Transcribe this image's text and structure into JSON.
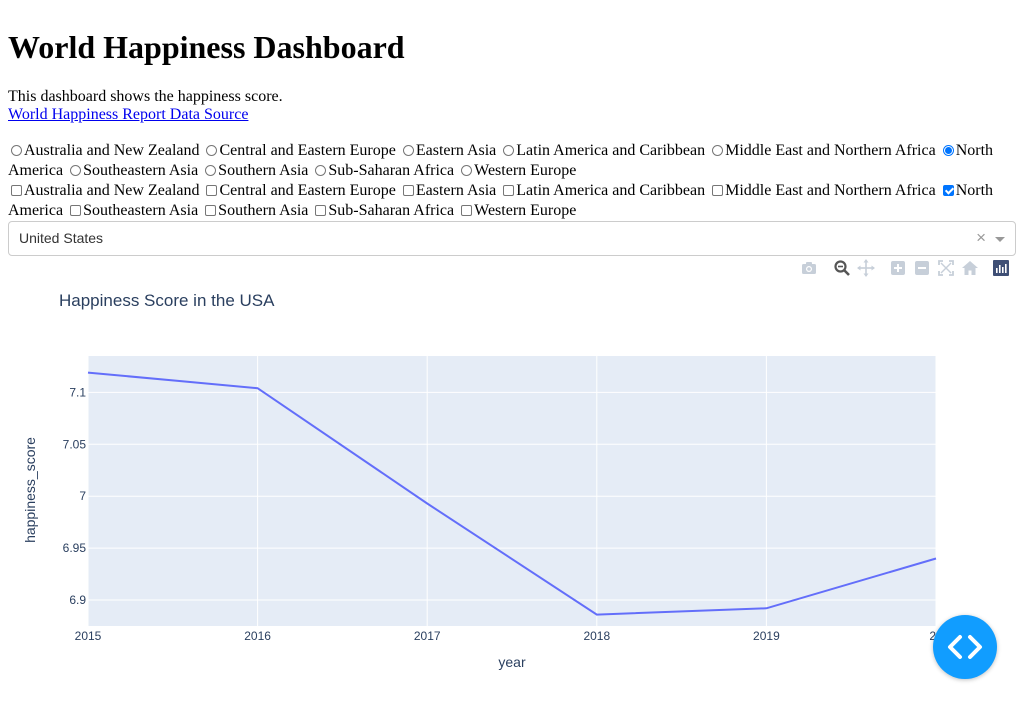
{
  "page": {
    "title": "World Happiness Dashboard",
    "description": "This dashboard shows the happiness score.",
    "link_text": "World Happiness Report Data Source"
  },
  "radio_group": {
    "options": [
      {
        "label": "Australia and New Zealand",
        "checked": false
      },
      {
        "label": "Central and Eastern Europe",
        "checked": false
      },
      {
        "label": "Eastern Asia",
        "checked": false
      },
      {
        "label": "Latin America and Caribbean",
        "checked": false
      },
      {
        "label": "Middle East and Northern Africa",
        "checked": false
      },
      {
        "label": "North America",
        "checked": true
      },
      {
        "label": "Southeastern Asia",
        "checked": false
      },
      {
        "label": "Southern Asia",
        "checked": false
      },
      {
        "label": "Sub-Saharan Africa",
        "checked": false
      },
      {
        "label": "Western Europe",
        "checked": false
      }
    ]
  },
  "checkbox_group": {
    "options": [
      {
        "label": "Australia and New Zealand",
        "checked": false
      },
      {
        "label": "Central and Eastern Europe",
        "checked": false
      },
      {
        "label": "Eastern Asia",
        "checked": false
      },
      {
        "label": "Latin America and Caribbean",
        "checked": false
      },
      {
        "label": "Middle East and Northern Africa",
        "checked": false
      },
      {
        "label": "North America",
        "checked": true
      },
      {
        "label": "Southeastern Asia",
        "checked": false
      },
      {
        "label": "Southern Asia",
        "checked": false
      },
      {
        "label": "Sub-Saharan Africa",
        "checked": false
      },
      {
        "label": "Western Europe",
        "checked": false
      }
    ]
  },
  "dropdown": {
    "selected": "United States",
    "clear_symbol": "×"
  },
  "modebar": {
    "icons": [
      "camera-icon",
      "zoom-icon",
      "pan-icon",
      "zoom-in-icon",
      "zoom-out-icon",
      "autoscale-icon",
      "home-icon",
      "plotly-logo-icon"
    ]
  },
  "colors": {
    "line": "#636efa",
    "plot_bg": "#e5ecf6",
    "fab": "#119dff",
    "link": "#0000ee"
  },
  "chart_data": {
    "type": "line",
    "title": "Happiness Score in the USA",
    "xlabel": "year",
    "ylabel": "happiness_score",
    "x": [
      2015,
      2016,
      2017,
      2018,
      2019,
      2020
    ],
    "x_tick_labels": [
      "2015",
      "2016",
      "2017",
      "2018",
      "2019",
      "20"
    ],
    "y_tick_labels": [
      "6.9",
      "6.95",
      "7",
      "7.05",
      "7.1"
    ],
    "series": [
      {
        "values": [
          7.119,
          7.104,
          6.993,
          6.886,
          6.892,
          6.94
        ]
      }
    ],
    "xlim": [
      2015,
      2020
    ],
    "ylim": [
      6.875,
      7.135
    ],
    "grid": true
  }
}
